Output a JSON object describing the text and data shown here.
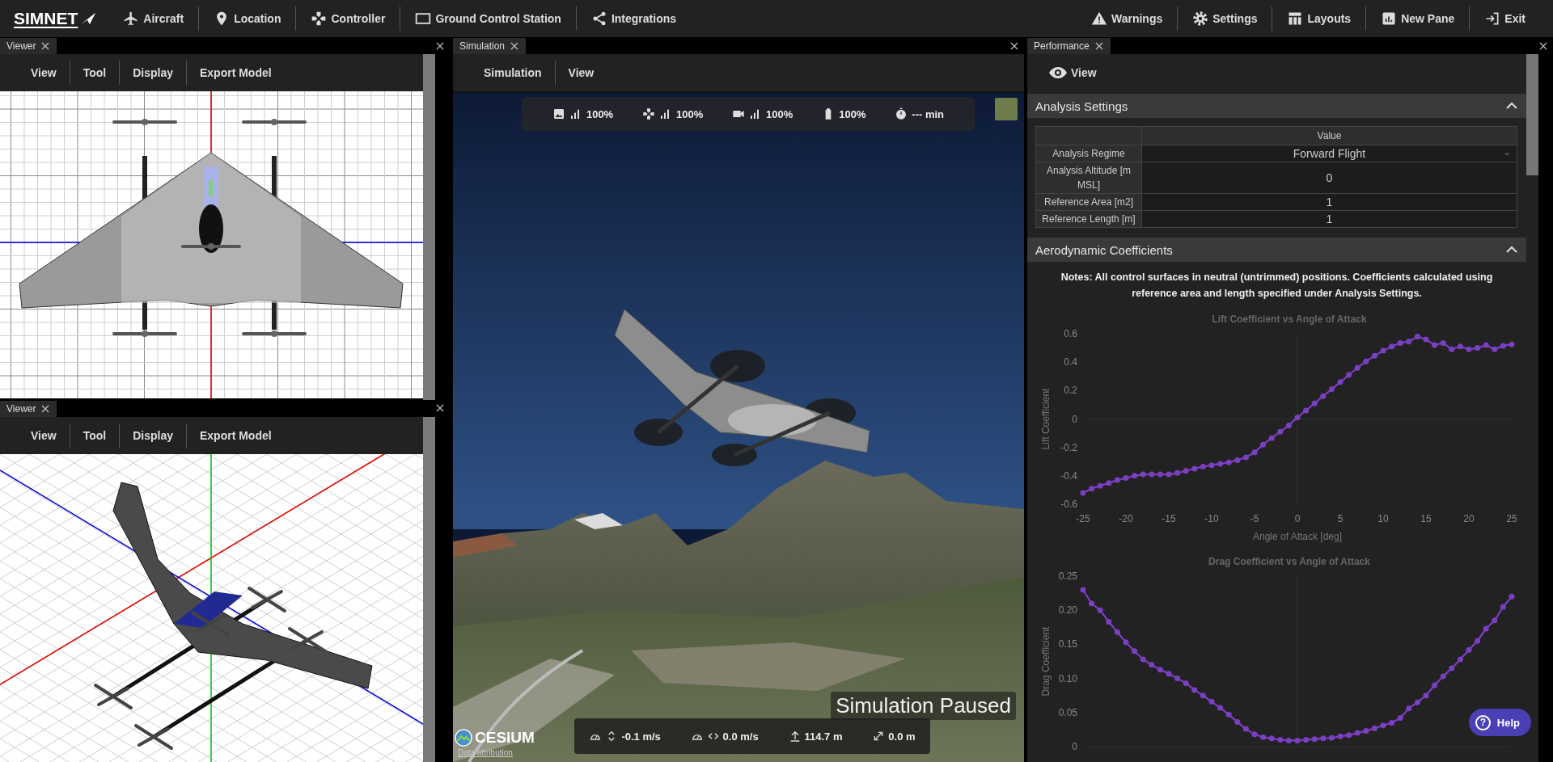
{
  "app_bar": {
    "logo": "SIMNET",
    "nav_left": [
      {
        "label": "Aircraft"
      },
      {
        "label": "Location"
      },
      {
        "label": "Controller"
      },
      {
        "label": "Ground Control Station"
      },
      {
        "label": "Integrations"
      }
    ],
    "nav_right": [
      {
        "label": "Warnings"
      },
      {
        "label": "Settings"
      },
      {
        "label": "Layouts"
      },
      {
        "label": "New Pane"
      },
      {
        "label": "Exit"
      }
    ]
  },
  "viewer_panes": [
    {
      "tab": "Viewer",
      "kind": "top",
      "menu": [
        "View",
        "Tool",
        "Display",
        "Export Model"
      ]
    },
    {
      "tab": "Viewer",
      "kind": "isometric",
      "menu": [
        "View",
        "Tool",
        "Display",
        "Export Model"
      ]
    }
  ],
  "simulation_pane": {
    "tab": "Simulation",
    "menu": [
      "Simulation",
      "View"
    ],
    "status_items": [
      {
        "value": "100%"
      },
      {
        "value": "100%"
      },
      {
        "value": "100%"
      },
      {
        "value": "100%"
      },
      {
        "value": "--- min"
      }
    ],
    "status_text": "Simulation Paused",
    "telemetry": [
      {
        "value": "-0.1 m/s"
      },
      {
        "value": "0.0 m/s"
      },
      {
        "value": "114.7 m"
      },
      {
        "value": "0.0 m"
      }
    ],
    "attribution": {
      "logo": "CESIUM",
      "link": "Data attribution"
    }
  },
  "performance_pane": {
    "tab": "Performance",
    "menu": [
      "View"
    ],
    "sections": [
      {
        "title": "Analysis Settings",
        "expanded": true,
        "table": {
          "columns": [
            "Value"
          ],
          "rows": [
            {
              "label": "Analysis Regime",
              "value": "Forward Flight",
              "kind": "dropdown"
            },
            {
              "label": "Analysis Altitude [m MSL]",
              "value": "0",
              "kind": "number"
            },
            {
              "label": "Reference Area [m2]",
              "value": "1",
              "kind": "number"
            },
            {
              "label": "Reference Length [m]",
              "value": "1",
              "kind": "number"
            }
          ]
        }
      },
      {
        "title": "Aerodynamic Coefficients",
        "expanded": true,
        "notes": "Notes: All control surfaces in neutral (untrimmed) positions. Coefficients calculated using reference area and length specified under Analysis Settings.",
        "charts": [
          {
            "chart_data": {
              "type": "line",
              "title": "Lift Coefficient vs Angle of Attack",
              "xlabel": "Angle of Attack [deg]",
              "ylabel": "Lift Coefficient",
              "x": [
                -25,
                -24,
                -23,
                -22,
                -21,
                -20,
                -19,
                -18,
                -17,
                -16,
                -15,
                -14,
                -13,
                -12,
                -11,
                -10,
                -9,
                -8,
                -7,
                -6,
                -5,
                -4,
                -3,
                -2,
                -1,
                0,
                1,
                2,
                3,
                4,
                5,
                6,
                7,
                8,
                9,
                10,
                11,
                12,
                13,
                14,
                15,
                16,
                17,
                18,
                19,
                20,
                21,
                22,
                23,
                24,
                25
              ],
              "series": [
                {
                  "color": "#7b3fc4",
                  "marker": true,
                  "values": [
                    -0.52,
                    -0.49,
                    -0.47,
                    -0.45,
                    -0.43,
                    -0.415,
                    -0.4,
                    -0.39,
                    -0.39,
                    -0.39,
                    -0.39,
                    -0.38,
                    -0.365,
                    -0.35,
                    -0.335,
                    -0.325,
                    -0.315,
                    -0.305,
                    -0.29,
                    -0.27,
                    -0.235,
                    -0.18,
                    -0.135,
                    -0.09,
                    -0.045,
                    0.01,
                    0.06,
                    0.11,
                    0.16,
                    0.21,
                    0.26,
                    0.31,
                    0.36,
                    0.405,
                    0.445,
                    0.48,
                    0.51,
                    0.535,
                    0.545,
                    0.58,
                    0.56,
                    0.52,
                    0.535,
                    0.49,
                    0.51,
                    0.49,
                    0.5,
                    0.52,
                    0.49,
                    0.515,
                    0.525
                  ]
                }
              ],
              "xlim": [
                -25,
                25
              ],
              "ylim": [
                -0.6,
                0.6
              ],
              "xticks": [
                -25,
                -20,
                -15,
                -10,
                -5,
                0,
                5,
                10,
                15,
                20,
                25
              ],
              "yticks": [
                -0.6,
                -0.4,
                -0.2,
                0,
                0.2,
                0.4,
                0.6
              ]
            }
          },
          {
            "chart_data": {
              "type": "line",
              "title": "Drag Coefficient vs Angle of Attack",
              "ylabel": "Drag Coefficient",
              "x": [
                -25,
                -24,
                -23,
                -22,
                -21,
                -20,
                -19,
                -18,
                -17,
                -16,
                -15,
                -14,
                -13,
                -12,
                -11,
                -10,
                -9,
                -8,
                -7,
                -6,
                -5,
                -4,
                -3,
                -2,
                -1,
                0,
                1,
                2,
                3,
                4,
                5,
                6,
                7,
                8,
                9,
                10,
                11,
                12,
                13,
                14,
                15,
                16,
                17,
                18,
                19,
                20,
                21,
                22,
                23,
                24,
                25
              ],
              "series": [
                {
                  "color": "#7b3fc4",
                  "marker": true,
                  "values": [
                    0.23,
                    0.21,
                    0.2,
                    0.183,
                    0.168,
                    0.153,
                    0.14,
                    0.128,
                    0.12,
                    0.113,
                    0.107,
                    0.1,
                    0.093,
                    0.083,
                    0.075,
                    0.066,
                    0.057,
                    0.047,
                    0.036,
                    0.026,
                    0.018,
                    0.014,
                    0.012,
                    0.01,
                    0.009,
                    0.009,
                    0.01,
                    0.011,
                    0.012,
                    0.013,
                    0.015,
                    0.017,
                    0.02,
                    0.023,
                    0.027,
                    0.031,
                    0.035,
                    0.042,
                    0.056,
                    0.065,
                    0.075,
                    0.09,
                    0.103,
                    0.115,
                    0.128,
                    0.142,
                    0.155,
                    0.173,
                    0.185,
                    0.205,
                    0.22
                  ]
                }
              ],
              "xlim": [
                -25,
                25
              ],
              "ylim": [
                0,
                0.25
              ],
              "yticks": [
                {
                  "value": 0,
                  "label": "0"
                },
                {
                  "value": 0.05,
                  "label": "0.05"
                },
                {
                  "value": 0.1,
                  "label": "0.10"
                },
                {
                  "value": 0.15,
                  "label": "0.15"
                },
                {
                  "value": 0.2,
                  "label": "0.20"
                },
                {
                  "value": 0.25,
                  "label": "0.25"
                }
              ]
            }
          }
        ]
      }
    ]
  },
  "help_button": {
    "icon": "?",
    "label": "Help"
  }
}
